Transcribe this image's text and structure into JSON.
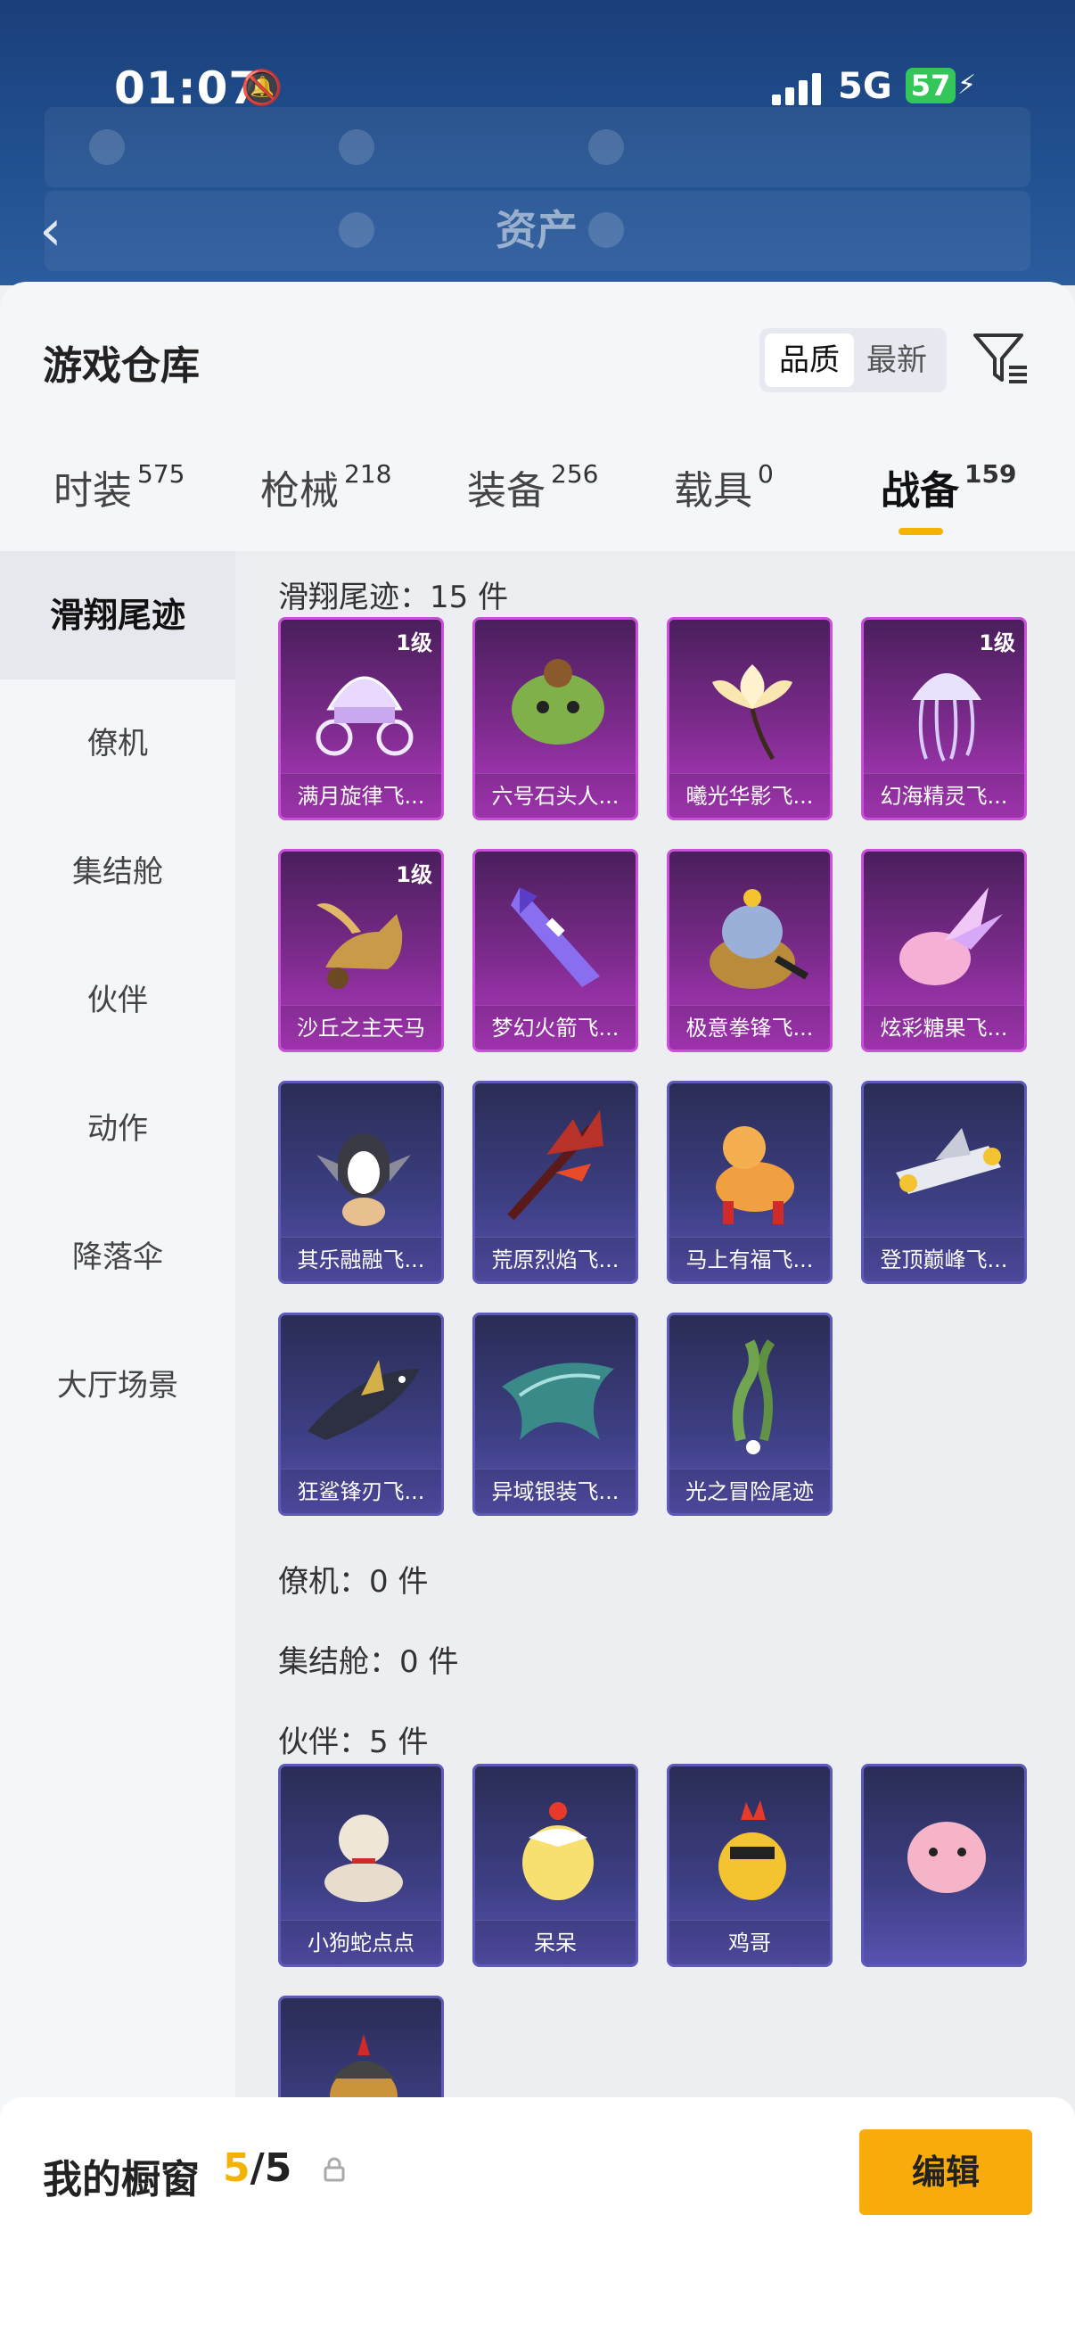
{
  "status": {
    "time": "01:07",
    "network": "5G",
    "battery": "57"
  },
  "header": {
    "title": "资产"
  },
  "sheet": {
    "title": "游戏仓库"
  },
  "sort": {
    "options": [
      "品质",
      "最新"
    ],
    "selected": "品质"
  },
  "category_tabs": [
    {
      "label": "时装",
      "count": "575"
    },
    {
      "label": "枪械",
      "count": "218"
    },
    {
      "label": "装备",
      "count": "256"
    },
    {
      "label": "载具",
      "count": "0"
    },
    {
      "label": "战备",
      "count": "159",
      "active": true
    }
  ],
  "sidebar": [
    {
      "label": "滑翔尾迹",
      "active": true
    },
    {
      "label": "僚机"
    },
    {
      "label": "集结舱"
    },
    {
      "label": "伙伴"
    },
    {
      "label": "动作"
    },
    {
      "label": "降落伞"
    },
    {
      "label": "大厅场景"
    }
  ],
  "sections": [
    {
      "title": "滑翔尾迹：15 件",
      "items": [
        {
          "name": "满月旋律飞...",
          "level": "1级",
          "rarity": "purple",
          "icon": "carriage-icon"
        },
        {
          "name": "六号石头人...",
          "rarity": "purple",
          "icon": "stone-creature-icon"
        },
        {
          "name": "曦光华影飞...",
          "rarity": "purple",
          "icon": "flower-icon"
        },
        {
          "name": "幻海精灵飞...",
          "level": "1级",
          "rarity": "purple",
          "icon": "jellyfish-icon"
        },
        {
          "name": "沙丘之主天马",
          "level": "1级",
          "rarity": "purple",
          "icon": "pegasus-icon"
        },
        {
          "name": "梦幻火箭飞...",
          "rarity": "purple",
          "icon": "rocket-icon"
        },
        {
          "name": "极意拳锋飞...",
          "rarity": "purple",
          "icon": "elephant-icon"
        },
        {
          "name": "炫彩糖果飞...",
          "rarity": "purple",
          "icon": "candy-icon"
        },
        {
          "name": "其乐融融飞...",
          "rarity": "blue",
          "icon": "penguin-icon"
        },
        {
          "name": "荒原烈焰飞...",
          "rarity": "blue",
          "icon": "flame-wing-icon"
        },
        {
          "name": "马上有福飞...",
          "rarity": "blue",
          "icon": "horse-icon"
        },
        {
          "name": "登顶巅峰飞...",
          "rarity": "blue",
          "icon": "jet-icon"
        },
        {
          "name": "狂鲨锋刃飞...",
          "rarity": "blue",
          "icon": "shark-icon"
        },
        {
          "name": "异域银装飞...",
          "rarity": "blue",
          "icon": "wing-icon"
        },
        {
          "name": "光之冒险尾迹",
          "rarity": "blue",
          "icon": "smoke-trail-icon"
        }
      ]
    },
    {
      "title": "僚机：0 件",
      "items": []
    },
    {
      "title": "集结舱：0 件",
      "items": []
    },
    {
      "title": "伙伴：5 件",
      "items": [
        {
          "name": "小狗蛇点点",
          "rarity": "blue",
          "icon": "snake-dog-icon"
        },
        {
          "name": "呆呆",
          "rarity": "blue",
          "icon": "chick-icon"
        },
        {
          "name": "鸡哥",
          "rarity": "blue",
          "icon": "rooster-icon"
        },
        {
          "name": "",
          "rarity": "blue",
          "icon": "pink-creature-icon"
        },
        {
          "name": "",
          "rarity": "blue",
          "icon": "warrior-icon"
        }
      ]
    }
  ],
  "showcase": {
    "title": "我的橱窗",
    "current": "5",
    "separator": "/",
    "total": "5",
    "edit_label": "编辑"
  },
  "colors": {
    "accent": "#f8ab0a",
    "purple_tile": "#b33bc4",
    "blue_tile": "#5852b0"
  }
}
